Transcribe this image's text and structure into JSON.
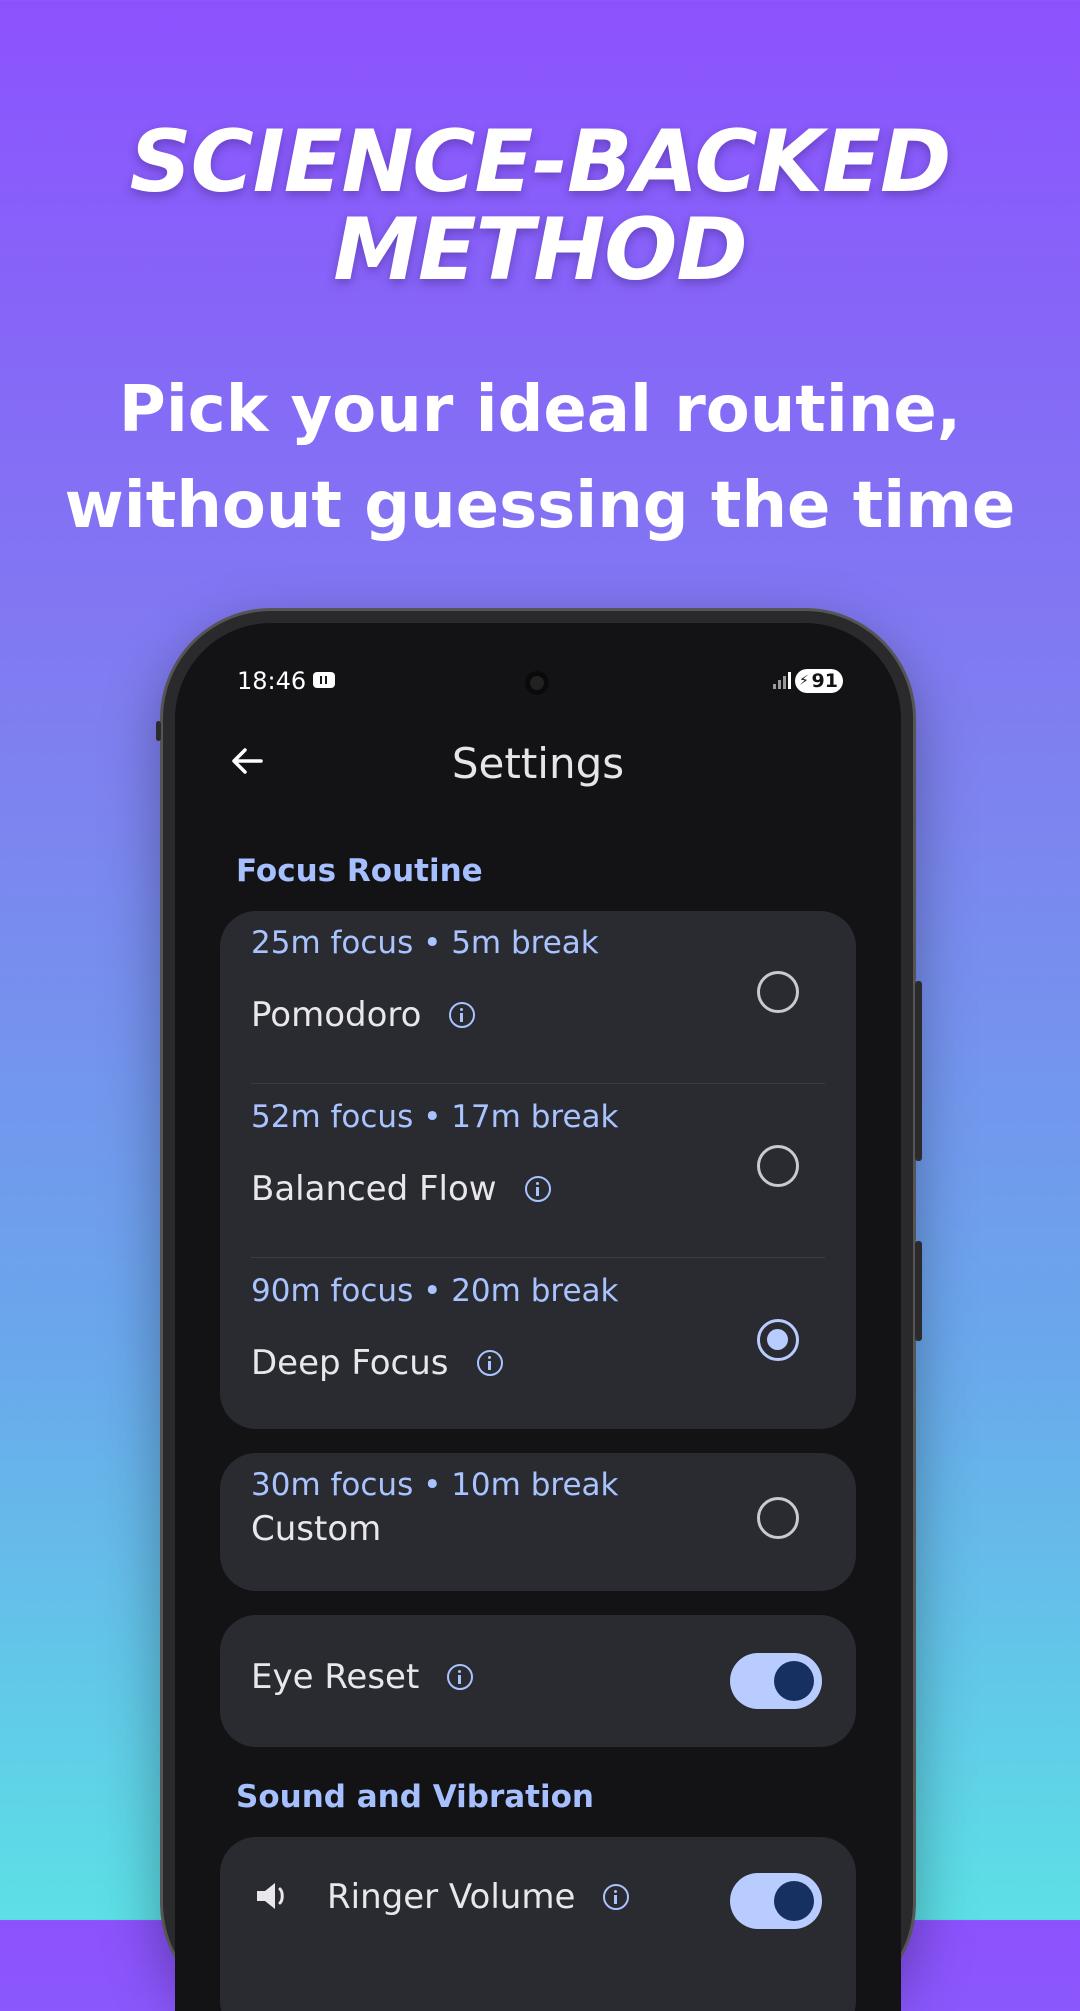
{
  "headline": {
    "line1": "SCIENCE-BACKED",
    "line2": "METHOD"
  },
  "subheadline": {
    "line1": "Pick your ideal routine,",
    "line2": "without guessing the time"
  },
  "status_bar": {
    "time": "18:46",
    "battery": "91"
  },
  "app_bar": {
    "title": "Settings",
    "back_icon": "arrow-left-icon"
  },
  "sections": {
    "focus_routine": "Focus Routine",
    "sound_vibration": "Sound and Vibration"
  },
  "routines": [
    {
      "meta": "25m focus • 5m break",
      "name": "Pomodoro",
      "selected": false
    },
    {
      "meta": "52m focus • 17m break",
      "name": "Balanced Flow",
      "selected": false
    },
    {
      "meta": "90m focus • 20m break",
      "name": "Deep Focus",
      "selected": true
    }
  ],
  "custom": {
    "meta": "30m focus • 10m break",
    "name": "Custom",
    "selected": false
  },
  "eye_reset": {
    "label": "Eye Reset",
    "enabled": true
  },
  "ringer_volume": {
    "label": "Ringer Volume",
    "enabled": true,
    "icon": "speaker-icon"
  },
  "colors": {
    "accent": "#a9c3ff",
    "toggle_track": "#b9ccff",
    "toggle_thumb": "#163062",
    "card": "#2a2b31",
    "screen": "#131316"
  }
}
